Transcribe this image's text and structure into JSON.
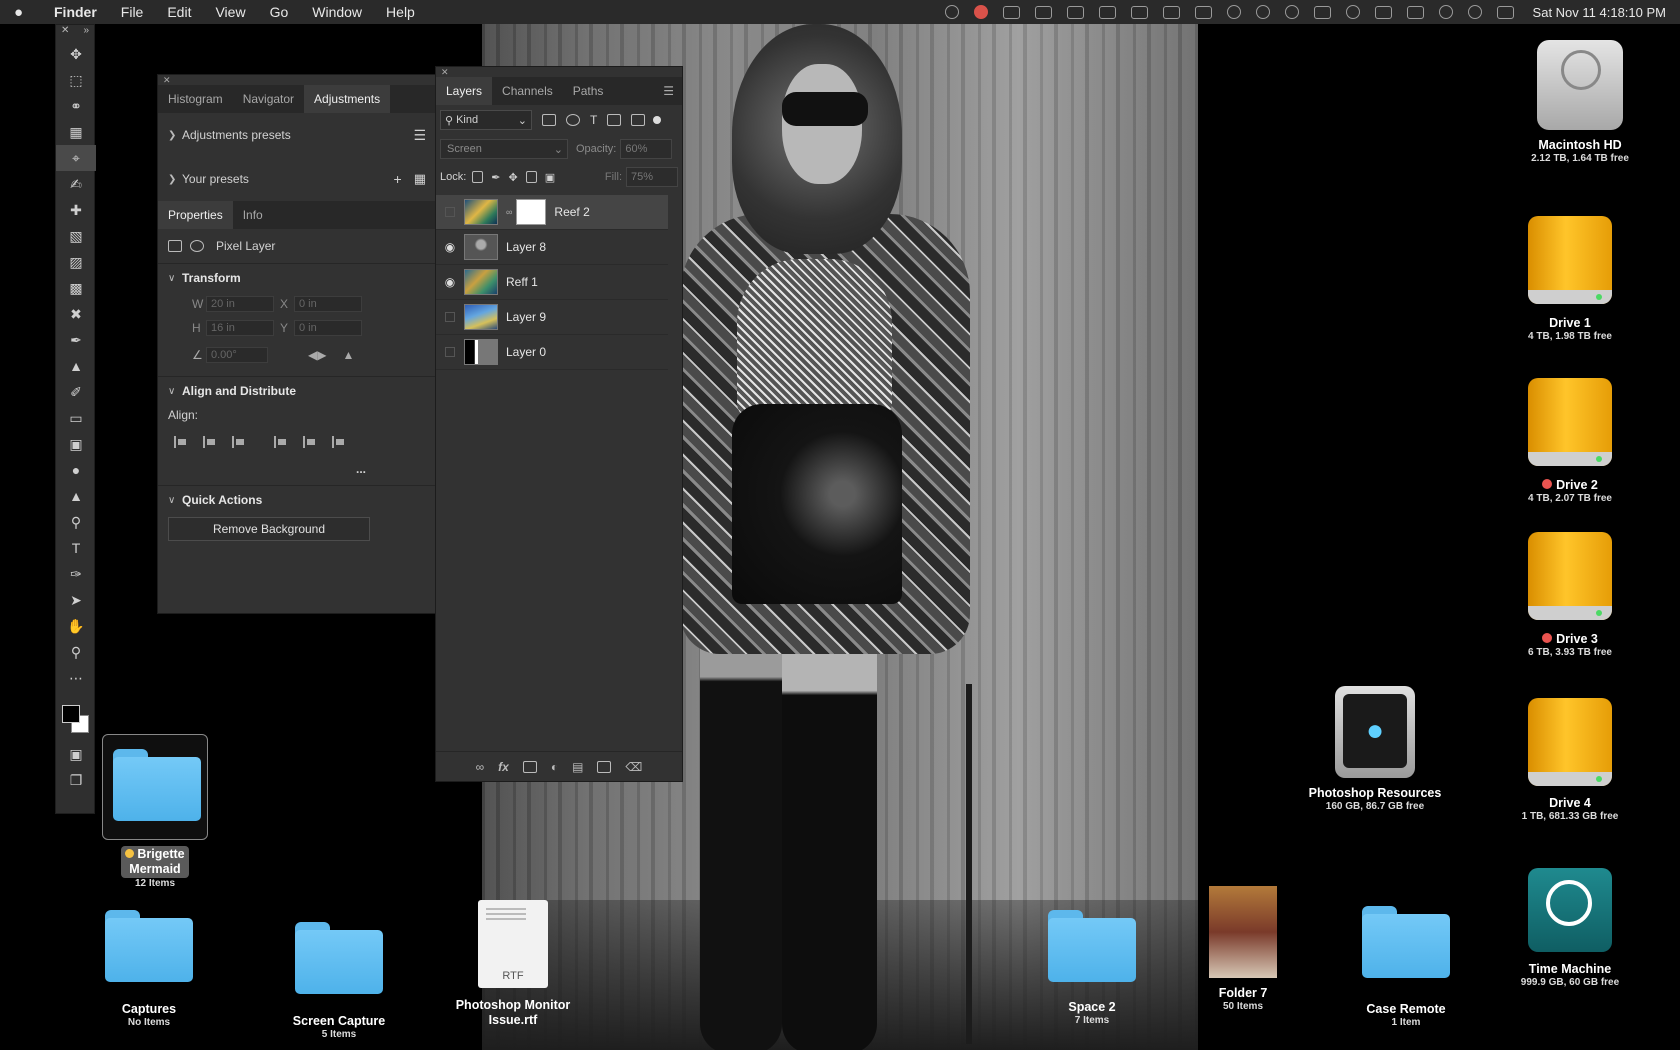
{
  "menubar": {
    "apple": "",
    "app_name": "Finder",
    "menus": [
      "File",
      "Edit",
      "View",
      "Go",
      "Window",
      "Help"
    ],
    "clock": "Sat Nov 11  4:18:10 PM"
  },
  "left_panel": {
    "tabs": [
      "Histogram",
      "Navigator",
      "Adjustments"
    ],
    "active_tab": "Adjustments",
    "adjustments_presets": "Adjustments presets",
    "your_presets": "Your presets",
    "prop_tabs": [
      "Properties",
      "Info"
    ],
    "pixel_layer": "Pixel Layer",
    "transform": {
      "title": "Transform",
      "w_label": "W",
      "w_value": "20 in",
      "x_label": "X",
      "x_value": "0 in",
      "h_label": "H",
      "h_value": "16 in",
      "y_label": "Y",
      "y_value": "0 in",
      "angle_value": "0.00°"
    },
    "align": {
      "title": "Align and Distribute",
      "align_label": "Align:",
      "more": "..."
    },
    "quick_actions": {
      "title": "Quick Actions",
      "remove_bg": "Remove Background"
    }
  },
  "layers_panel": {
    "tabs": [
      "Layers",
      "Channels",
      "Paths"
    ],
    "active_tab": "Layers",
    "kind_label": "Kind",
    "blend_mode": "Screen",
    "opacity_label": "Opacity:",
    "opacity_value": "60%",
    "lock_label": "Lock:",
    "fill_label": "Fill:",
    "fill_value": "75%",
    "layers": [
      {
        "name": "Reef 2",
        "visible": false,
        "selected": true
      },
      {
        "name": "Layer 8",
        "visible": true,
        "selected": false
      },
      {
        "name": "Reff 1",
        "visible": true,
        "selected": false
      },
      {
        "name": "Layer 9",
        "visible": false,
        "selected": false
      },
      {
        "name": "Layer 0",
        "visible": false,
        "selected": false
      }
    ],
    "footer_icons": [
      "link-icon",
      "fx-icon",
      "mask-icon",
      "adjustment-icon",
      "group-folder-icon",
      "new-layer-icon",
      "trash-icon"
    ]
  },
  "toolbar": {
    "tools": [
      "move-icon",
      "marquee-icon",
      "lasso-icon",
      "object-select-icon",
      "crop-icon",
      "eyedropper-icon",
      "spot-heal-icon",
      "bandaid-icon",
      "patch-icon",
      "frame-icon",
      "content-aware-move-icon",
      "brush-icon",
      "stamp-icon",
      "history-brush-icon",
      "eraser-icon",
      "gradient-icon",
      "blur-icon",
      "sharpen-icon",
      "dodge-icon",
      "type-icon",
      "pen-icon",
      "path-select-icon",
      "hand-icon",
      "zoom-icon",
      "more-icon"
    ],
    "active": "crop-icon"
  },
  "desktop": {
    "drives": [
      {
        "name": "Macintosh HD",
        "sub": "2.12 TB, 1.64 TB free"
      },
      {
        "name": "Drive 1",
        "sub": "4 TB, 1.98 TB free"
      },
      {
        "name": "Drive 2",
        "sub": "4 TB, 2.07 TB free",
        "tag": "red"
      },
      {
        "name": "Drive 3",
        "sub": "6 TB, 3.93 TB free",
        "tag": "red"
      },
      {
        "name": "Drive 4",
        "sub": "1 TB, 681.33 GB free"
      }
    ],
    "photoshop_resources": {
      "name": "Photoshop Resources",
      "sub": "160 GB, 86.7 GB free"
    },
    "time_machine": {
      "name": "Time Machine",
      "sub": "999.9 GB, 60 GB free"
    },
    "brigette": {
      "name_line1": "Brigette",
      "name_line2": "Mermaid",
      "sub": "12 Items"
    },
    "captures": {
      "name": "Captures",
      "sub": "No Items"
    },
    "screen_capture": {
      "name": "Screen Capture",
      "sub": "5 Items"
    },
    "rtf_file": {
      "name_line1": "Photoshop Monitor",
      "name_line2": "Issue.rtf",
      "badge": "RTF"
    },
    "space2": {
      "name": "Space 2",
      "sub": "7 Items"
    },
    "folder7": {
      "name": "Folder 7",
      "sub": "50 Items"
    },
    "case_remote": {
      "name": "Case Remote",
      "sub": "1 Item"
    }
  }
}
